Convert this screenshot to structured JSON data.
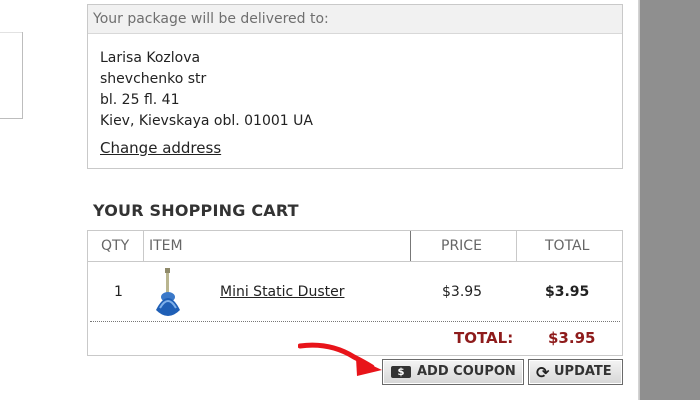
{
  "delivery": {
    "header": "Your package will be delivered to:",
    "address_lines": [
      "Larisa Kozlova",
      "shevchenko str",
      "bl. 25 fl. 41",
      "Kiev, Kievskaya obl. 01001 UA"
    ],
    "change_address_link": "Change address"
  },
  "cart": {
    "title": "YOUR SHOPPING CART",
    "columns": {
      "qty": "QTY",
      "item": "ITEM",
      "price": "PRICE",
      "total": "TOTAL"
    },
    "items": [
      {
        "qty": "1",
        "name": "Mini Static Duster",
        "price": "$3.95",
        "total": "$3.95"
      }
    ],
    "total_label": "TOTAL:",
    "total_value": "$3.95",
    "buttons": {
      "coupon_icon_text": "$",
      "add_coupon": "ADD COUPON",
      "update_icon": "refresh-icon",
      "update": "UPDATE"
    }
  },
  "colors": {
    "total_red": "#8e1b1b",
    "arrow_red": "#e8141a",
    "side_panel_gray": "#8f8f8f"
  }
}
